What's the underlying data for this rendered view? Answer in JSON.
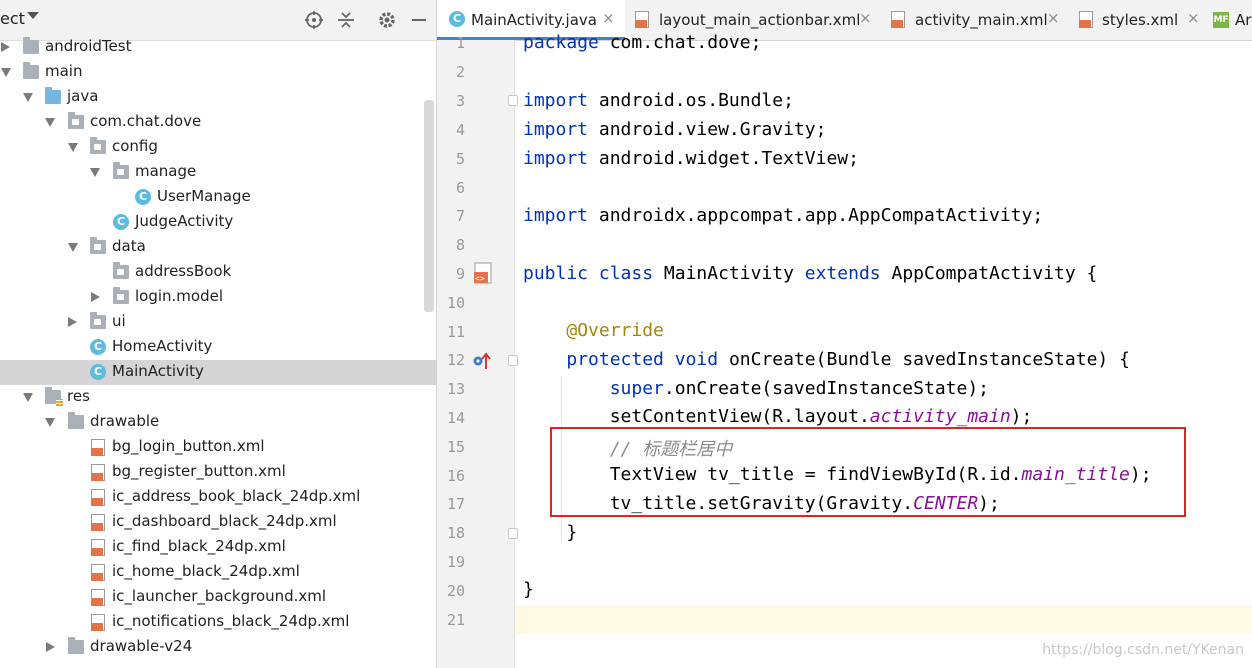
{
  "project_panel": {
    "title": "ect",
    "tree": [
      {
        "label": "androidTest",
        "icon": "folder-icon",
        "selected": false
      },
      {
        "label": "main",
        "icon": "folder-icon",
        "selected": false
      },
      {
        "label": "java",
        "icon": "source-folder-icon",
        "selected": false
      },
      {
        "label": "com.chat.dove",
        "icon": "package-icon",
        "selected": false
      },
      {
        "label": "config",
        "icon": "package-icon",
        "selected": false
      },
      {
        "label": "manage",
        "icon": "package-icon",
        "selected": false
      },
      {
        "label": "UserManage",
        "icon": "class-icon",
        "selected": false
      },
      {
        "label": "JudgeActivity",
        "icon": "class-icon",
        "selected": false
      },
      {
        "label": "data",
        "icon": "package-icon",
        "selected": false
      },
      {
        "label": "addressBook",
        "icon": "package-icon",
        "selected": false
      },
      {
        "label": "login.model",
        "icon": "package-icon",
        "selected": false
      },
      {
        "label": "ui",
        "icon": "package-icon",
        "selected": false
      },
      {
        "label": "HomeActivity",
        "icon": "class-icon",
        "selected": false
      },
      {
        "label": "MainActivity",
        "icon": "class-icon",
        "selected": true
      },
      {
        "label": "res",
        "icon": "resource-folder-icon",
        "selected": false
      },
      {
        "label": "drawable",
        "icon": "folder-icon",
        "selected": false
      },
      {
        "label": "bg_login_button.xml",
        "icon": "xml-file-icon",
        "selected": false
      },
      {
        "label": "bg_register_button.xml",
        "icon": "xml-file-icon",
        "selected": false
      },
      {
        "label": "ic_address_book_black_24dp.xml",
        "icon": "xml-file-icon",
        "selected": false
      },
      {
        "label": "ic_dashboard_black_24dp.xml",
        "icon": "xml-file-icon",
        "selected": false
      },
      {
        "label": "ic_find_black_24dp.xml",
        "icon": "xml-file-icon",
        "selected": false
      },
      {
        "label": "ic_home_black_24dp.xml",
        "icon": "xml-file-icon",
        "selected": false
      },
      {
        "label": "ic_launcher_background.xml",
        "icon": "xml-file-icon",
        "selected": false
      },
      {
        "label": "ic_notifications_black_24dp.xml",
        "icon": "xml-file-icon",
        "selected": false
      },
      {
        "label": "drawable-v24",
        "icon": "folder-icon",
        "selected": false
      }
    ]
  },
  "tabs": [
    {
      "label": "MainActivity.java",
      "icon": "java-class-icon",
      "active": true
    },
    {
      "label": "layout_main_actionbar.xml",
      "icon": "xml-file-icon",
      "active": false
    },
    {
      "label": "activity_main.xml",
      "icon": "xml-file-icon",
      "active": false
    },
    {
      "label": "styles.xml",
      "icon": "xml-file-icon",
      "active": false
    },
    {
      "label": "Ar",
      "icon": "manifest-icon",
      "active": false
    }
  ],
  "tab_close_glyph": "×",
  "editor": {
    "line_numbers": [
      "1",
      "2",
      "3",
      "4",
      "5",
      "6",
      "7",
      "8",
      "9",
      "10",
      "11",
      "12",
      "13",
      "14",
      "15",
      "16",
      "17",
      "18",
      "19",
      "20",
      "21"
    ],
    "lines": {
      "l1": [
        "package",
        " com.chat.dove;"
      ],
      "l3": [
        "import",
        " android.os.Bundle;"
      ],
      "l4": [
        "import",
        " android.view.Gravity;"
      ],
      "l5": [
        "import",
        " android.widget.TextView;"
      ],
      "l7": [
        "import",
        " androidx.appcompat.app.AppCompatActivity;"
      ],
      "l9": [
        "public",
        " ",
        "class",
        " MainActivity ",
        "extends",
        " AppCompatActivity {"
      ],
      "l11": [
        "    ",
        "@Override"
      ],
      "l12": [
        "    ",
        "protected",
        " ",
        "void",
        " onCreate(Bundle savedInstanceState) {"
      ],
      "l13": [
        "        ",
        "super",
        ".onCreate(savedInstanceState);"
      ],
      "l14": [
        "        setContentView(R.layout.",
        "activity_main",
        ");"
      ],
      "l15": [
        "        ",
        "// 标题栏居中"
      ],
      "l16": [
        "        TextView tv_title = findViewById(R.id.",
        "main_title",
        ");"
      ],
      "l17": [
        "        tv_title.setGravity(Gravity.",
        "CENTER",
        ");"
      ],
      "l18": [
        "    }"
      ],
      "l20": [
        "}"
      ]
    },
    "current_line": "21",
    "highlight_color": "#dd2323"
  },
  "watermark": "https://blog.csdn.net/YKenan",
  "colors": {
    "keyword": "#0033b3",
    "annotation": "#9e880d",
    "italic_member": "#871094",
    "comment": "#8c8c8c",
    "selection": "#d5d5d5",
    "accent": "#4083c9"
  }
}
